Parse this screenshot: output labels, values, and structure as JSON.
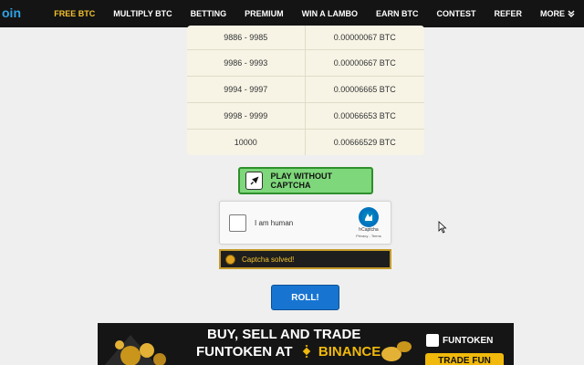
{
  "nav": {
    "logo_text": "oin",
    "items": [
      {
        "label": "FREE BTC",
        "active": true
      },
      {
        "label": "MULTIPLY BTC",
        "active": false
      },
      {
        "label": "BETTING",
        "active": false
      },
      {
        "label": "PREMIUM",
        "active": false
      },
      {
        "label": "WIN A LAMBO",
        "active": false
      },
      {
        "label": "EARN BTC",
        "active": false
      },
      {
        "label": "CONTEST",
        "active": false
      },
      {
        "label": "REFER",
        "active": false
      }
    ],
    "more_label": "MORE"
  },
  "prize_table": {
    "rows": [
      {
        "range": "9886 - 9985",
        "payout": "0.00000067 BTC"
      },
      {
        "range": "9986 - 9993",
        "payout": "0.00000667 BTC"
      },
      {
        "range": "9994 - 9997",
        "payout": "0.00006665 BTC"
      },
      {
        "range": "9998 - 9999",
        "payout": "0.00066653 BTC"
      },
      {
        "range": "10000",
        "payout": "0.00666529 BTC"
      }
    ]
  },
  "play_button": {
    "label": "PLAY WITHOUT CAPTCHA",
    "icon": "rocket-icon"
  },
  "captcha": {
    "label": "I am human",
    "brand": "hCaptcha",
    "links": "Privacy - Terms",
    "icon": "hcaptcha-logo-icon"
  },
  "captcha_status": {
    "label": "Captcha solved!"
  },
  "roll_button": {
    "label": "ROLL!"
  },
  "banner": {
    "line1": "BUY, SELL AND TRADE",
    "line2_prefix": "FUNTOKEN AT",
    "line2_exchange": "BINANCE",
    "brand": "FUNTOKEN",
    "cta": "TRADE FUN"
  },
  "colors": {
    "nav_bg": "#141414",
    "nav_active": "#f3c22e",
    "play_bg": "#7ed77a",
    "roll_bg": "#1775d1",
    "binance_yellow": "#f0b90b"
  }
}
